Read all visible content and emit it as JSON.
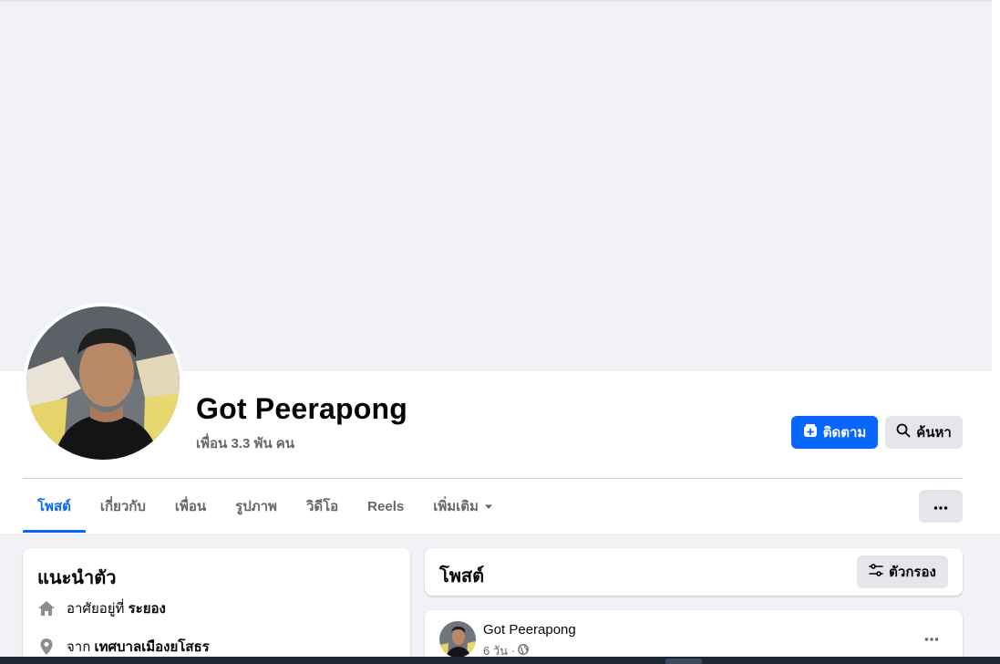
{
  "profile": {
    "name": "Got Peerapong",
    "friends_text": "เพื่อน 3.3 พัน คน"
  },
  "actions": {
    "follow_label": "ติดตาม",
    "search_label": "ค้นหา"
  },
  "tabs": [
    {
      "label": "โพสต์",
      "active": true
    },
    {
      "label": "เกี่ยวกับ",
      "active": false
    },
    {
      "label": "เพื่อน",
      "active": false
    },
    {
      "label": "รูปภาพ",
      "active": false
    },
    {
      "label": "วิดีโอ",
      "active": false
    },
    {
      "label": "Reels",
      "active": false
    },
    {
      "label": "เพิ่มเติม",
      "active": false
    }
  ],
  "intro": {
    "title": "แนะนำตัว",
    "lives_prefix": "อาศัยอยู่ที่",
    "lives_value": "ระยอง",
    "from_prefix": "จาก",
    "from_value": "เทศบาลเมืองยโสธร"
  },
  "posts_section": {
    "title": "โพสต์",
    "filter_label": "ตัวกรอง"
  },
  "post": {
    "author": "Got Peerapong",
    "time": "6 วัน ·"
  },
  "colors": {
    "accent": "#0866ff",
    "secondary_button": "#e4e6eb",
    "background": "#f0f2f5",
    "muted_text": "#65676b"
  },
  "icons": {
    "follow": "user-plus-icon",
    "search": "search-icon",
    "more_tab": "caret-down-icon",
    "more_button": "more-dots-icon",
    "home": "home-icon",
    "location": "location-pin-icon",
    "filter": "filter-sliders-icon",
    "privacy": "globe-icon"
  }
}
